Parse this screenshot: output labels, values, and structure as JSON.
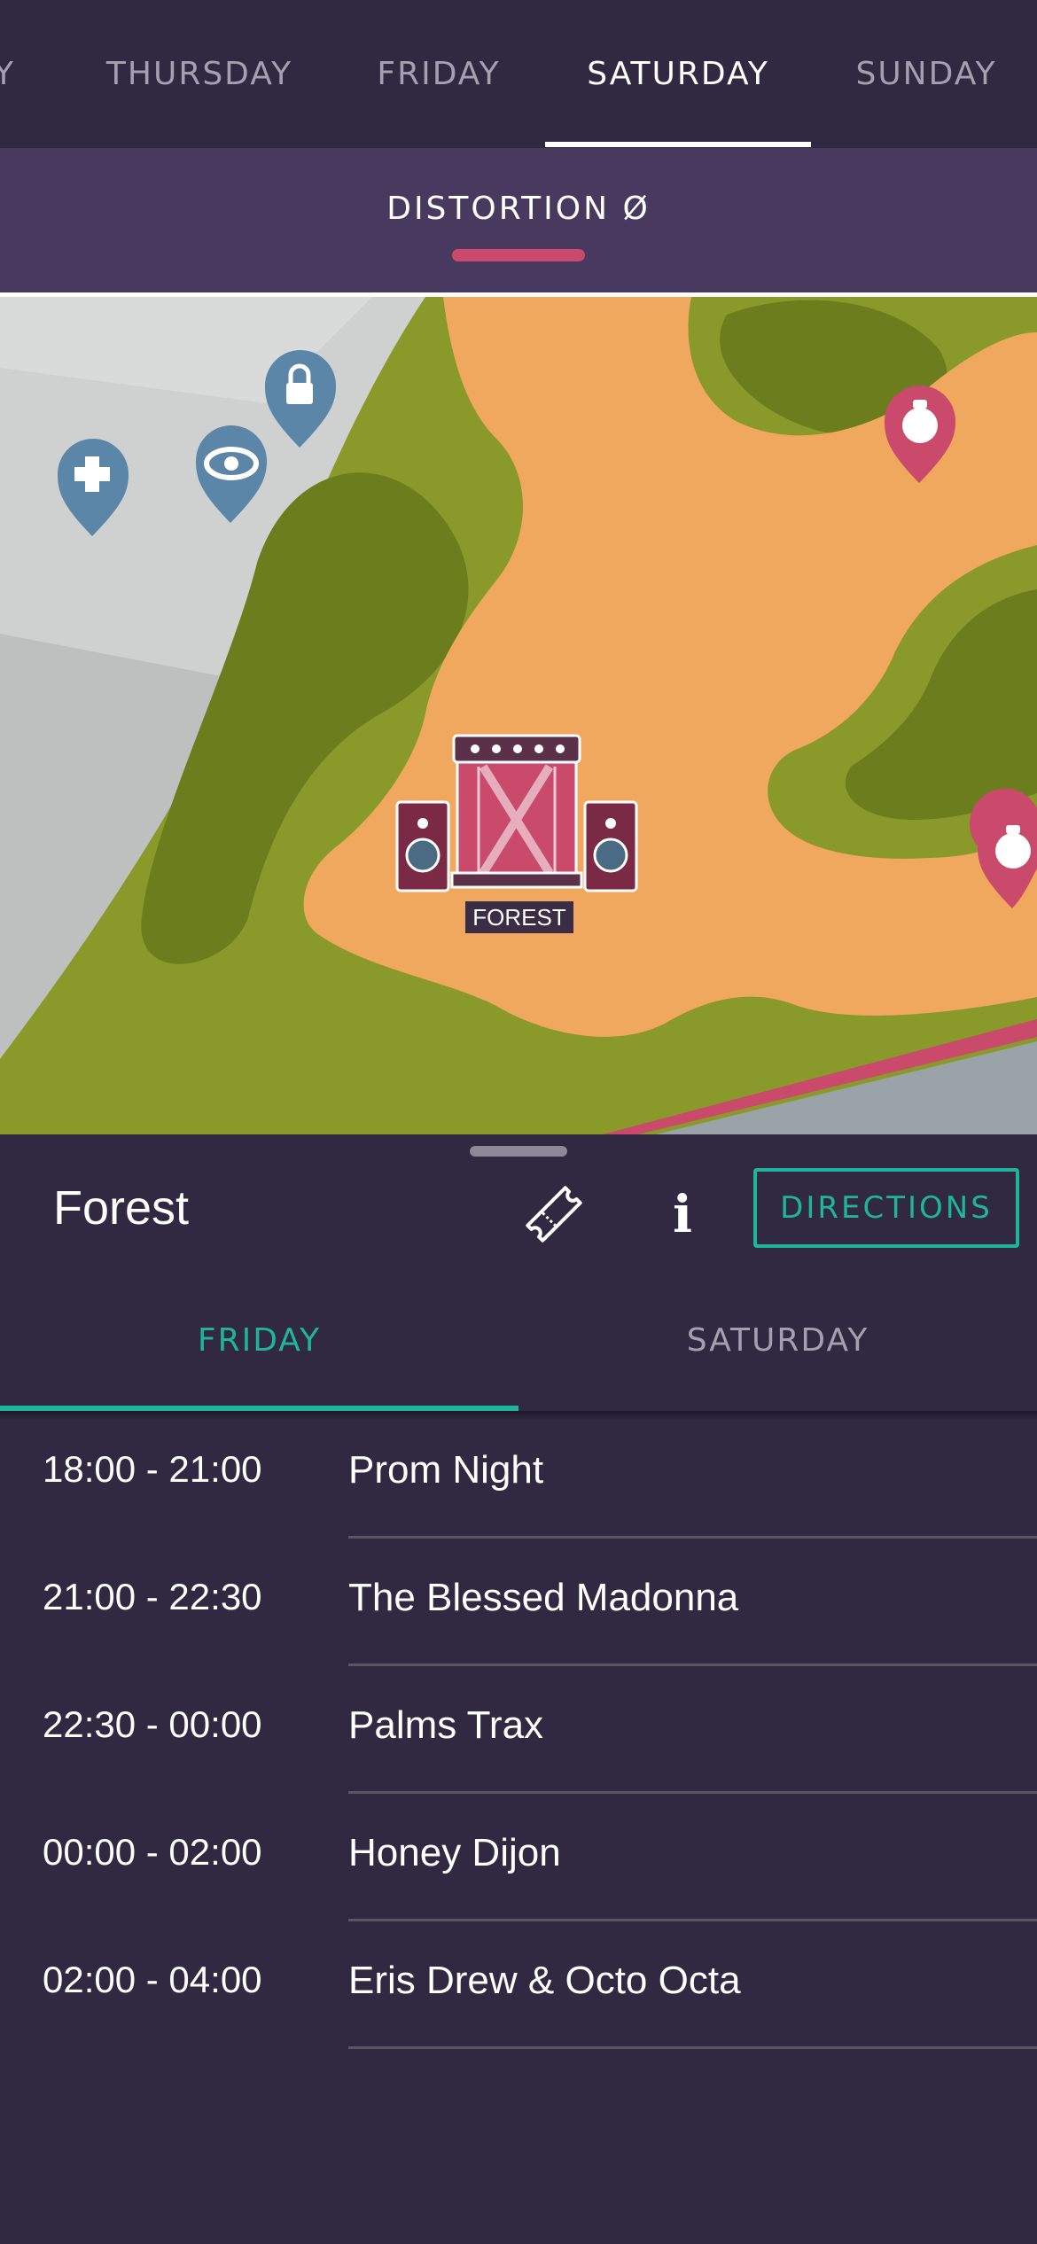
{
  "day_tabs": [
    {
      "label": "Y",
      "active": false
    },
    {
      "label": "THURSDAY",
      "active": false
    },
    {
      "label": "FRIDAY",
      "active": false
    },
    {
      "label": "SATURDAY",
      "active": true
    },
    {
      "label": "SUNDAY",
      "active": false
    }
  ],
  "area": {
    "label": "DISTORTION Ø"
  },
  "map": {
    "stage_label": "FOREST",
    "markers": [
      "first-aid-icon",
      "viewpoint-eye-icon",
      "lockers-lock-icon",
      "toilet-pin-icon",
      "toilet-pin-icon"
    ],
    "colors": {
      "grass": "#8a9a2a",
      "dark_grass": "#6c7d1e",
      "sand": "#f0a75e",
      "street": "#c9c9c9",
      "pin_blue": "#5b86a8",
      "pin_red": "#c94a6a"
    }
  },
  "venue": {
    "title": "Forest",
    "ticket_icon": "ticket-icon",
    "info_icon": "info-icon",
    "info_glyph": "i",
    "directions_label": "DIRECTIONS"
  },
  "schedule_tabs": [
    {
      "label": "FRIDAY",
      "active": true
    },
    {
      "label": "SATURDAY",
      "active": false
    }
  ],
  "schedule": [
    {
      "time": "18:00 - 21:00",
      "act": "Prom Night"
    },
    {
      "time": "21:00 - 22:30",
      "act": "The Blessed Madonna"
    },
    {
      "time": "22:30 - 00:00",
      "act": "Palms Trax"
    },
    {
      "time": "00:00 - 02:00",
      "act": "Honey Dijon"
    },
    {
      "time": "02:00 - 04:00",
      "act": "Eris Drew & Octo Octa"
    }
  ],
  "colors": {
    "accent": "#1fb59c",
    "background": "#312841",
    "area_bar": "#483a5e",
    "area_underline": "#c94a6a"
  }
}
